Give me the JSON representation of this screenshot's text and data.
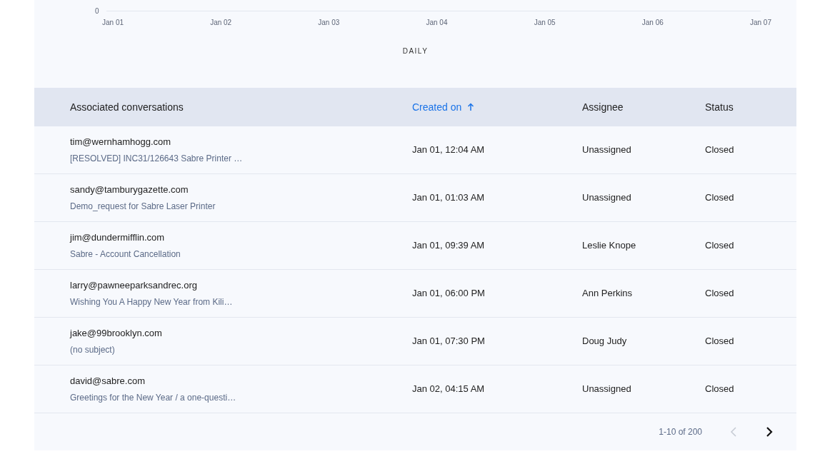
{
  "chart": {
    "y_tick": "0",
    "x_labels": [
      "Jan 01",
      "Jan 02",
      "Jan 03",
      "Jan 04",
      "Jan 05",
      "Jan 06",
      "Jan 07"
    ],
    "caption": "DAILY"
  },
  "table": {
    "columns": [
      {
        "label": "Associated conversations",
        "sorted": false
      },
      {
        "label": "Created on",
        "sorted": true
      },
      {
        "label": "Assignee",
        "sorted": false
      },
      {
        "label": "Status",
        "sorted": false
      }
    ],
    "rows": [
      {
        "email": "tim@wernhamhogg.com",
        "subject": "[RESOLVED] INC31/126643 Sabre Printer …",
        "created": "Jan 01, 12:04 AM",
        "assignee": "Unassigned",
        "status": "Closed"
      },
      {
        "email": "sandy@tamburygazette.com",
        "subject": "Demo_request for Sabre Laser Printer",
        "created": "Jan 01, 01:03 AM",
        "assignee": "Unassigned",
        "status": "Closed"
      },
      {
        "email": "jim@dundermifflin.com",
        "subject": "Sabre - Account Cancellation",
        "created": "Jan 01, 09:39 AM",
        "assignee": "Leslie Knope",
        "status": "Closed"
      },
      {
        "email": "larry@pawneeparksandrec.org",
        "subject": "Wishing You A Happy New Year from Kili…",
        "created": "Jan 01, 06:00 PM",
        "assignee": "Ann Perkins",
        "status": "Closed"
      },
      {
        "email": "jake@99brooklyn.com",
        "subject": "(no subject)",
        "created": "Jan 01, 07:30 PM",
        "assignee": "Doug Judy",
        "status": "Closed"
      },
      {
        "email": "david@sabre.com",
        "subject": "Greetings for the New Year / a one-questi…",
        "created": "Jan 02, 04:15 AM",
        "assignee": "Unassigned",
        "status": "Closed"
      }
    ]
  },
  "pagination": {
    "range": "1-10 of 200",
    "prev_disabled": true,
    "next_disabled": false
  }
}
